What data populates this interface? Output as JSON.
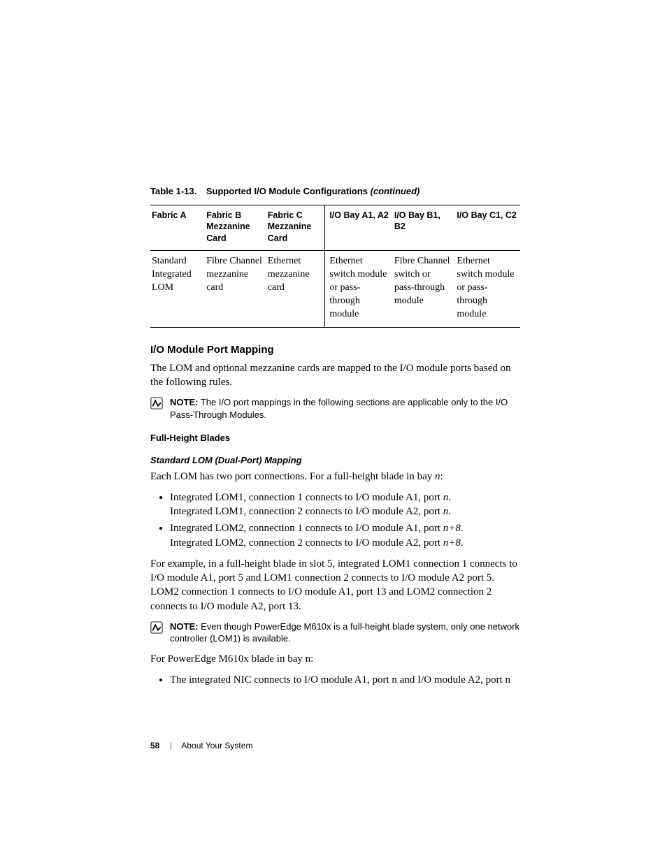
{
  "tableCaption": {
    "number": "Table 1-13.",
    "title": "Supported I/O Module Configurations",
    "continued": "(continued)"
  },
  "table": {
    "headers": [
      "Fabric A",
      "Fabric B Mezzanine Card",
      "Fabric C Mezzanine Card",
      "I/O Bay A1, A2",
      "I/O Bay B1, B2",
      "I/O Bay C1, C2"
    ],
    "row": [
      "Standard Integrated LOM",
      "Fibre Channel mezzanine card",
      "Ethernet mezzanine card",
      "Ethernet switch module or pass-through module",
      "Fibre Channel switch or pass-through module",
      "Ethernet switch module or pass-through module"
    ]
  },
  "sectionHeading": "I/O Module Port Mapping",
  "intro": "The LOM and optional mezzanine cards are mapped to the I/O module ports based on the following rules.",
  "note1": {
    "label": "NOTE:",
    "text": "The I/O port mappings in the following sections are applicable only to the I/O Pass-Through Modules."
  },
  "h3a": "Full-Height Blades",
  "h4a": "Standard LOM (Dual-Port) Mapping",
  "lomIntroPrefix": "Each LOM has two port connections. For a full-height blade in bay ",
  "lomIntroSuffix": ":",
  "bullet1": {
    "l1a": "Integrated LOM1, connection 1 connects to I/O module A1, port ",
    "l1b": ".",
    "l2a": "Integrated LOM1, connection 2 connects to I/O module A2, port ",
    "l2b": "."
  },
  "bullet2": {
    "l1a": "Integrated LOM2, connection 1 connects to I/O module A1, port ",
    "l1b": ".",
    "l2a": "Integrated LOM2, connection 2 connects to I/O module A2, port ",
    "l2b": "."
  },
  "varN": "n",
  "varN8": "n+8",
  "example": "For example, in a full-height blade in slot 5, integrated LOM1 connection 1 connects to I/O module A1, port 5 and LOM1 connection 2 connects to I/O module A2 port 5. LOM2 connection 1 connects to I/O module A1, port 13 and LOM2 connection 2 connects to I/O module A2, port 13.",
  "note2": {
    "label": "NOTE:",
    "text": "Even though PowerEdge M610x is a full-height blade system, only one network controller (LOM1) is available."
  },
  "para610x": "For PowerEdge M610x blade in bay n:",
  "bullet3": "The integrated NIC connects to I/O module A1, port n and I/O module A2, port n",
  "footer": {
    "page": "58",
    "section": "About Your System"
  }
}
